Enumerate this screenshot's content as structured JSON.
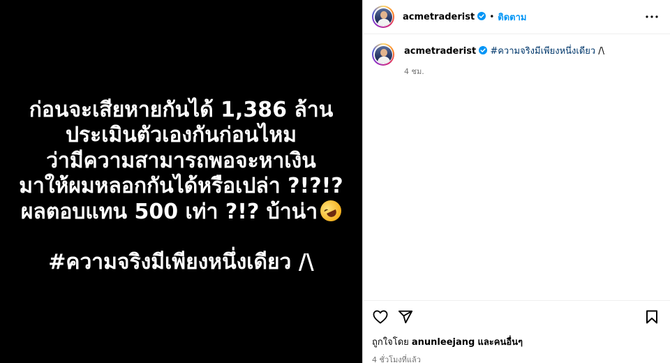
{
  "media": {
    "lines": [
      "ก่อนจะเสียหายกันได้ 1,386 ล้าน",
      "ประเมินตัวเองกันก่อนไหม",
      "ว่ามีความสามารถพอจะหาเงิน",
      "มาให้ผมหลอกกันได้หรือเปล่า ?!?!?",
      "ผลตอบแทน 500 เท่า ?!? บ้าน่า"
    ],
    "emoji": "rolling-on-floor-laughing-emoji",
    "hashtag_line": "#ความจริงมีเพียงหนึ่งเดียว /\\"
  },
  "header": {
    "username": "acmetraderist",
    "separator": "•",
    "follow_label": "ติดตาม"
  },
  "caption": {
    "username": "acmetraderist",
    "hashtag": "#ความจริงมีเพียงหนึ่งเดียว",
    "suffix": "/\\",
    "time": "4 ชม."
  },
  "footer": {
    "liked_prefix": "ถูกใจโดย",
    "liked_user": "anunleejang",
    "liked_suffix": "และคนอื่นๆ",
    "time": "4 ชั่วโมงที่แล้ว"
  },
  "colors": {
    "accent": "#0095f6",
    "hashtag": "#00376b",
    "verified": "#0095f6",
    "secondary_text": "#737373"
  },
  "icons": [
    "verified-badge-icon",
    "more-options-icon",
    "heart-icon",
    "share-icon",
    "bookmark-icon"
  ]
}
